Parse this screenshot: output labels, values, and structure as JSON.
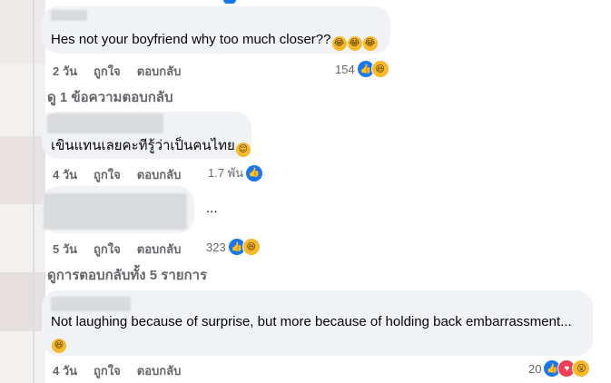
{
  "comments": [
    {
      "text": "Hes not your boyfriend why too much closer??",
      "emoji_names": [
        "rolling-laughing",
        "rolling-laughing",
        "rolling-laughing"
      ],
      "time": "2 วัน",
      "like": "ถูกใจ",
      "reply": "ตอบกลับ",
      "reaction_count": "154",
      "reactions": [
        "like-icon",
        "haha-icon"
      ]
    },
    {
      "text": "เขินแทนเลยคะทีรู้ว่าเป็นคนไทย",
      "emoji_names": [
        "relieved"
      ],
      "time": "4 วัน",
      "like": "ถูกใจ",
      "reply": "ตอบกลับ",
      "reaction_count": "1.7 พัน",
      "reactions": [
        "like-icon"
      ]
    },
    {
      "text": "...",
      "time": "5 วัน",
      "like": "ถูกใจ",
      "reply": "ตอบกลับ",
      "reaction_count": "323",
      "reactions": [
        "like-icon",
        "haha-icon"
      ]
    },
    {
      "text": "Not laughing because of surprise, but more because of holding back embarrassment...",
      "emoji_names": [
        "grinning-squinting"
      ],
      "time": "4 วัน",
      "like": "ถูกใจ",
      "reply": "ตอบกลับ",
      "reaction_count": "20",
      "reactions": [
        "like-icon",
        "heart-icon",
        "wow-icon"
      ]
    }
  ],
  "view_replies_1": "ดู 1 ข้อความตอบกลับ",
  "view_replies_all": "ดูการตอบกลับทั้ง 5 รายการ",
  "colors": {
    "bubble": "#f0f2f5",
    "meta": "#65676b",
    "like_blue": "#1877f2",
    "haha_yellow": "#f7b928",
    "heart_red": "#f33e58"
  }
}
